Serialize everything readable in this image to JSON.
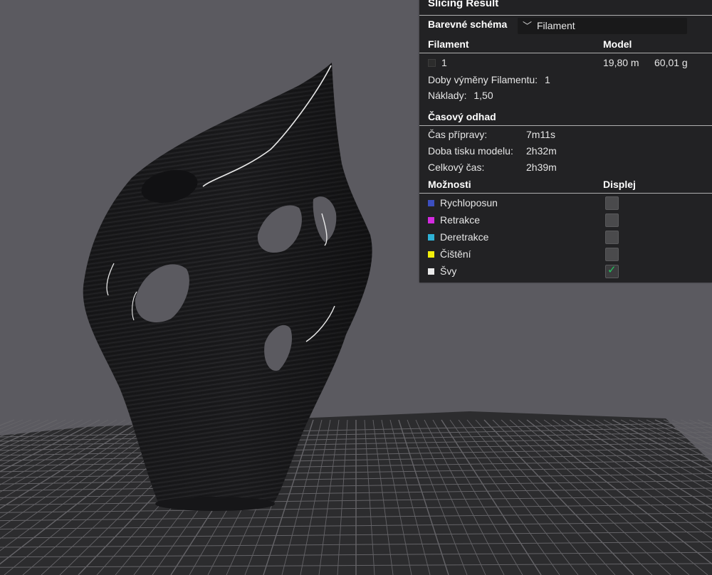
{
  "panel": {
    "title": "Slicing Result",
    "color_scheme_label": "Barevné schéma",
    "color_scheme_value": "Filament",
    "filament_header": "Filament",
    "model_header": "Model",
    "filament_rows": [
      {
        "name": "1",
        "length": "19,80 m",
        "weight": "60,01 g",
        "swatch_color": "#2c2c2c"
      }
    ],
    "filament_changes_label": "Doby výměny Filamentu:",
    "filament_changes_value": "1",
    "cost_label": "Náklady:",
    "cost_value": "1,50",
    "time_header": "Časový odhad",
    "prep_label": "Čas přípravy:",
    "prep_value": "7m11s",
    "print_label": "Doba tisku modelu:",
    "print_value": "2h32m",
    "total_label": "Celkový čas:",
    "total_value": "2h39m",
    "options_header": "Možnosti",
    "display_header": "Displej",
    "options": [
      {
        "label": "Rychloposun",
        "color": "#3c4fc0",
        "checked": false
      },
      {
        "label": "Retrakce",
        "color": "#d42be0",
        "checked": false
      },
      {
        "label": "Deretrakce",
        "color": "#2fb2d6",
        "checked": false
      },
      {
        "label": "Čištění",
        "color": "#f2ee0b",
        "checked": false
      },
      {
        "label": "Švy",
        "color": "#eaeaea",
        "checked": true
      }
    ]
  },
  "viewport": {
    "background_color": "#5b5a60",
    "bed_color": "#2c2c2e",
    "grid_color": "#656468",
    "model_color": "#1a1a1c"
  }
}
